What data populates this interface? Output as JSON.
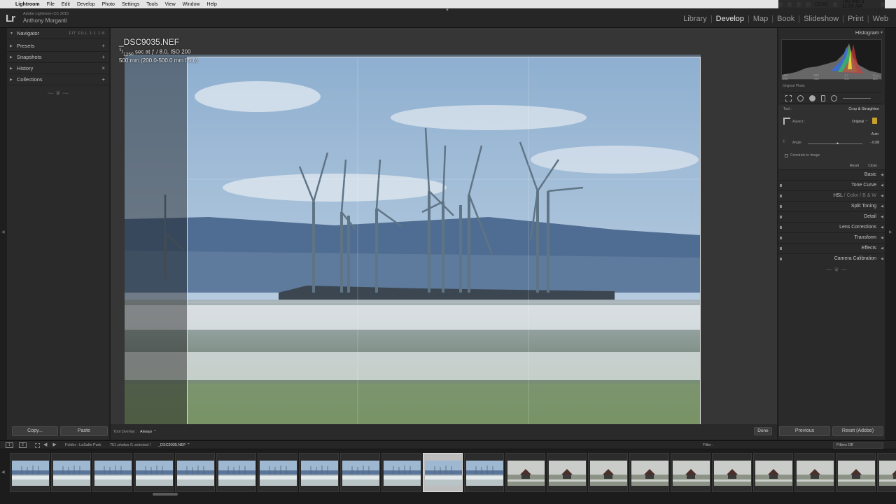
{
  "menubar": {
    "items": [
      "Lightroom",
      "File",
      "Edit",
      "Develop",
      "Photo",
      "Settings",
      "Tools",
      "View",
      "Window",
      "Help"
    ],
    "battery": "(11%)",
    "clock": "Thu Mar 9  11:05 AM"
  },
  "identity": {
    "logo": "Lr",
    "product": "Adobe Lightroom CC 2015",
    "user": "Anthony Morganti"
  },
  "modules": [
    "Library",
    "Develop",
    "Map",
    "Book",
    "Slideshow",
    "Print",
    "Web"
  ],
  "active_module": "Develop",
  "left_panel": {
    "navigator": "Navigator",
    "navigator_opts": "FIT  FILL  1:1  1:8",
    "presets": "Presets",
    "snapshots": "Snapshots",
    "history": "History",
    "collections": "Collections",
    "plus": "+",
    "close": "×",
    "ornament": "⁓ ❦ ⁓",
    "copy": "Copy...",
    "paste": "Paste"
  },
  "photo_info": {
    "filename": "_DSC9035.NEF",
    "exposure_num": "1",
    "exposure_den": "1250",
    "exposure_rest": " sec at ƒ / 8.0, ISO 200",
    "lens": "500 mm (200.0-500.0 mm f/5.6)"
  },
  "toolbar": {
    "overlay_label": "Tool Overlay :",
    "overlay_value": "Always ⌃",
    "done": "Done"
  },
  "right_panel": {
    "histogram_title": "Histogram",
    "hist_iso": "ISO 200",
    "hist_focal": "500 mm",
    "hist_aperture": "ƒ / 8.0",
    "hist_shutter": "¹⁄₁₂₅₀ sec",
    "original_photo": "Original Photo",
    "crop": {
      "tool_label": "Tool :",
      "title": "Crop & Straighten",
      "aspect_label": "Aspect :",
      "aspect_value": "Original ⌃",
      "auto": "Auto",
      "level_icon": "Ⓛ",
      "angle_label": "Angle",
      "angle_knob": "▲",
      "angle_value": "- 0.08",
      "constrain": "Constrain to Image",
      "reset": "Reset",
      "close": "Close"
    },
    "panels": [
      {
        "label": "Basic"
      },
      {
        "label": "Tone Curve"
      },
      {
        "label": "HSL"
      },
      {
        "label": "Split Toning"
      },
      {
        "label": "Detail"
      },
      {
        "label": "Lens Corrections"
      },
      {
        "label": "Transform"
      },
      {
        "label": "Effects"
      },
      {
        "label": "Camera Calibration"
      }
    ],
    "hsl_extra": {
      "sep": "/",
      "color": "Color",
      "bw": "B & W"
    },
    "ornament": "⁓ ❦ ⁓",
    "previous": "Previous",
    "reset_adobe": "Reset (Adobe)"
  },
  "filmstrip_bar": {
    "screen1": "1",
    "screen2": "2",
    "arrows": "◀ ▶",
    "folder": "Folder : LaSalle Park",
    "count": "751 photos /1 selected /",
    "selected": "_DSC9035.NEF ⌃",
    "filter_label": "Filter :",
    "filter_value": "Filters Off"
  },
  "filmstrip": {
    "thumbs": [
      "turbines",
      "turbines",
      "turbines",
      "turbines",
      "turbines",
      "turbines",
      "turbines",
      "turbines",
      "turbines",
      "turbines",
      "turbines",
      "turbines",
      "lighthouse",
      "lighthouse",
      "lighthouse",
      "lighthouse",
      "lighthouse",
      "lighthouse",
      "lighthouse",
      "lighthouse",
      "lighthouse",
      "lighthouse"
    ],
    "selected_index": 10
  },
  "colors": {
    "accent": "#e6e6e6",
    "panel": "#2a2a2a",
    "canvas": "#363636",
    "lock": "#c8a02a"
  }
}
